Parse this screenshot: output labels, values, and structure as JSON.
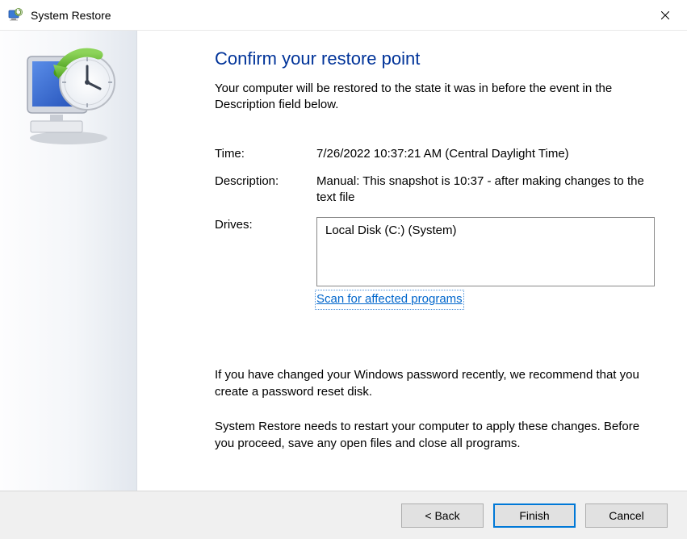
{
  "titlebar": {
    "app_title": "System Restore"
  },
  "main": {
    "heading": "Confirm your restore point",
    "subhead": "Your computer will be restored to the state it was in before the event in the Description field below.",
    "fields": {
      "time_label": "Time:",
      "time_value": "7/26/2022 10:37:21 AM (Central Daylight Time)",
      "desc_label": "Description:",
      "desc_value": "Manual: This snapshot is 10:37 - after making changes to the text file",
      "drives_label": "Drives:",
      "drives_value": "Local Disk (C:) (System)"
    },
    "scan_link": "Scan for affected programs",
    "para1": "If you have changed your Windows password recently, we recommend that you create a password reset disk.",
    "para2": "System Restore needs to restart your computer to apply these changes. Before you proceed, save any open files and close all programs."
  },
  "footer": {
    "back": "< Back",
    "finish": "Finish",
    "cancel": "Cancel"
  }
}
